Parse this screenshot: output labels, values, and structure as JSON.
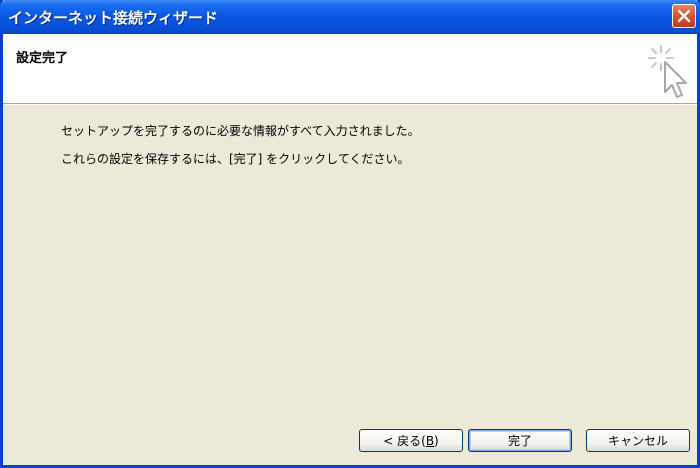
{
  "window": {
    "title": "インターネット接続ウィザード"
  },
  "header": {
    "title": "設定完了",
    "icon": "wizard-cursor-sparkle-icon"
  },
  "body": {
    "line1": "セットアップを完了するのに必要な情報がすべて入力されました。",
    "line2": "これらの設定を保存するには、[完了] をクリックしてください。"
  },
  "buttons": {
    "back_prefix": "< 戻る(",
    "back_key": "B",
    "back_suffix": ")",
    "finish": "完了",
    "cancel": "キャンセル"
  },
  "colors": {
    "titlebar": "#0a58e6",
    "dialog_bg": "#ece9d8",
    "close_button": "#d6532f"
  }
}
